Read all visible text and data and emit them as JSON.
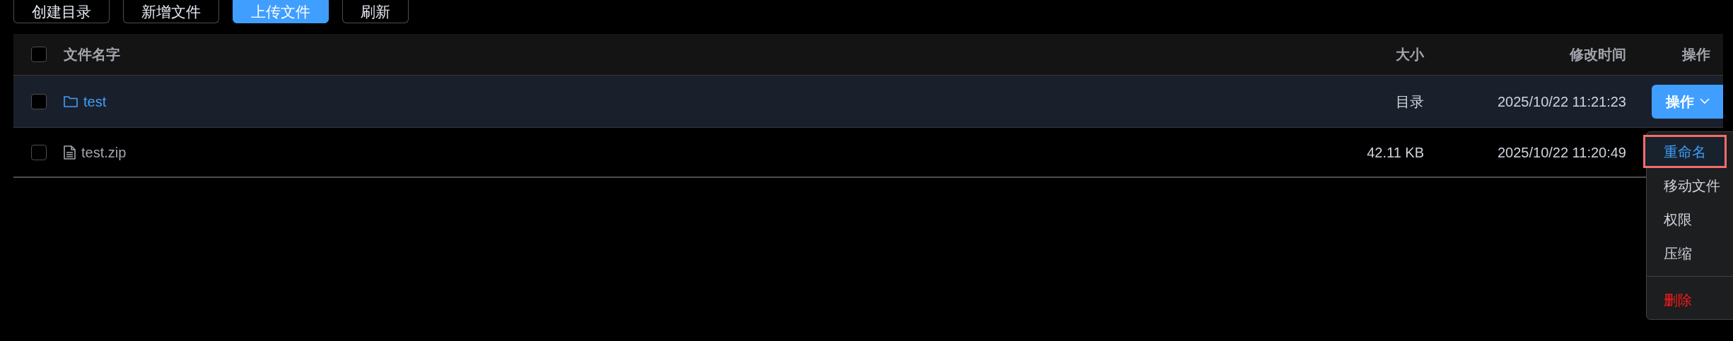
{
  "toolbar": [
    {
      "label": "创建目录",
      "kind": "default"
    },
    {
      "label": "新增文件",
      "kind": "default"
    },
    {
      "label": "上传文件",
      "kind": "primary"
    },
    {
      "label": "刷新",
      "kind": "default"
    }
  ],
  "table": {
    "select_all": {
      "checked": false
    },
    "columns": [
      "文件名字",
      "大小",
      "修改时间",
      "操作"
    ],
    "rows": [
      {
        "kind": "folder",
        "name": "test",
        "size": "目录",
        "modified": "2025/10/22 11:21:23",
        "highlighted": true,
        "checked": false,
        "action": "操作"
      },
      {
        "kind": "file",
        "name": "test.zip",
        "size": "42.11 KB",
        "modified": "2025/10/22 11:20:49",
        "highlighted": false,
        "checked": false
      }
    ]
  },
  "menu": {
    "items": [
      {
        "label": "重命名",
        "kind": "normal",
        "selected": true
      },
      {
        "label": "移动文件",
        "kind": "normal",
        "selected": false
      },
      {
        "label": "权限",
        "kind": "normal",
        "selected": false
      },
      {
        "label": "压缩",
        "kind": "normal",
        "selected": false
      },
      {
        "label": "删除",
        "kind": "danger",
        "selected": false
      }
    ]
  }
}
